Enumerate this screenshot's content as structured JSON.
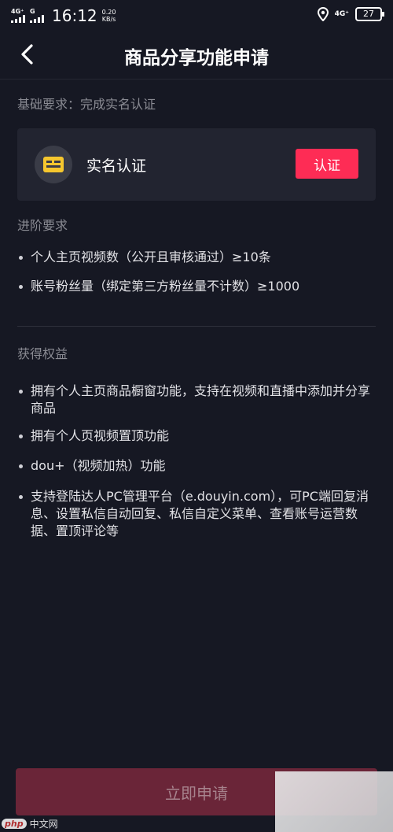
{
  "status_bar": {
    "sim1_label": "4G⁺",
    "sim2_label": "G",
    "time": "16:12",
    "speed_value": "0.20",
    "speed_unit": "KB/s",
    "network_label": "4G⁺",
    "battery": "27"
  },
  "nav": {
    "title": "商品分享功能申请"
  },
  "basic": {
    "section_title": "基础要求：完成实名认证",
    "card_label": "实名认证",
    "verify_button": "认证"
  },
  "advanced": {
    "section_title": "进阶要求",
    "items": [
      "个人主页视频数（公开且审核通过）≥10条",
      "账号粉丝量（绑定第三方粉丝量不计数）≥1000"
    ]
  },
  "benefits": {
    "section_title": "获得权益",
    "items": [
      "拥有个人主页商品橱窗功能，支持在视频和直播中添加并分享商品",
      "拥有个人页视频置顶功能",
      "dou+（视频加热）功能",
      "支持登陆达人PC管理平台（e.douyin.com），可PC端回复消息、设置私信自动回复、私信自定义菜单、查看账号运营数据、置顶评论等"
    ]
  },
  "footer": {
    "apply_button": "立即申请"
  },
  "watermark": {
    "logo": "php",
    "text": "中文网"
  },
  "colors": {
    "background": "#161823",
    "accent": "#fe2c55",
    "apply_disabled": "#6a2538",
    "card": "#222430"
  },
  "icons": [
    "back-arrow-icon",
    "id-card-icon",
    "location-icon",
    "battery-icon"
  ]
}
